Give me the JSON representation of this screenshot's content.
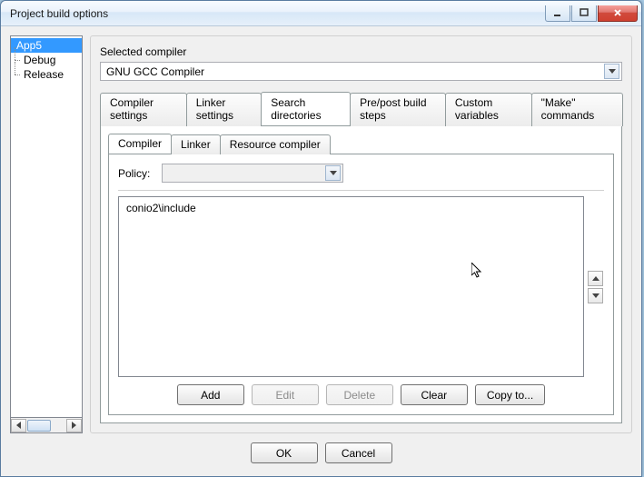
{
  "window": {
    "title": "Project build options"
  },
  "tree": {
    "items": [
      {
        "label": "App5",
        "selected": true
      },
      {
        "label": "Debug"
      },
      {
        "label": "Release"
      }
    ]
  },
  "compiler": {
    "label": "Selected compiler",
    "value": "GNU GCC Compiler"
  },
  "tabs": {
    "items": [
      "Compiler settings",
      "Linker settings",
      "Search directories",
      "Pre/post build steps",
      "Custom variables",
      "\"Make\" commands"
    ],
    "active": 2
  },
  "subtabs": {
    "items": [
      "Compiler",
      "Linker",
      "Resource compiler"
    ],
    "active": 0
  },
  "policy": {
    "label": "Policy:",
    "value": ""
  },
  "list": {
    "items": [
      "conio2\\include"
    ]
  },
  "listButtons": {
    "add": "Add",
    "edit": "Edit",
    "delete": "Delete",
    "clear": "Clear",
    "copy": "Copy to..."
  },
  "dialogButtons": {
    "ok": "OK",
    "cancel": "Cancel"
  }
}
